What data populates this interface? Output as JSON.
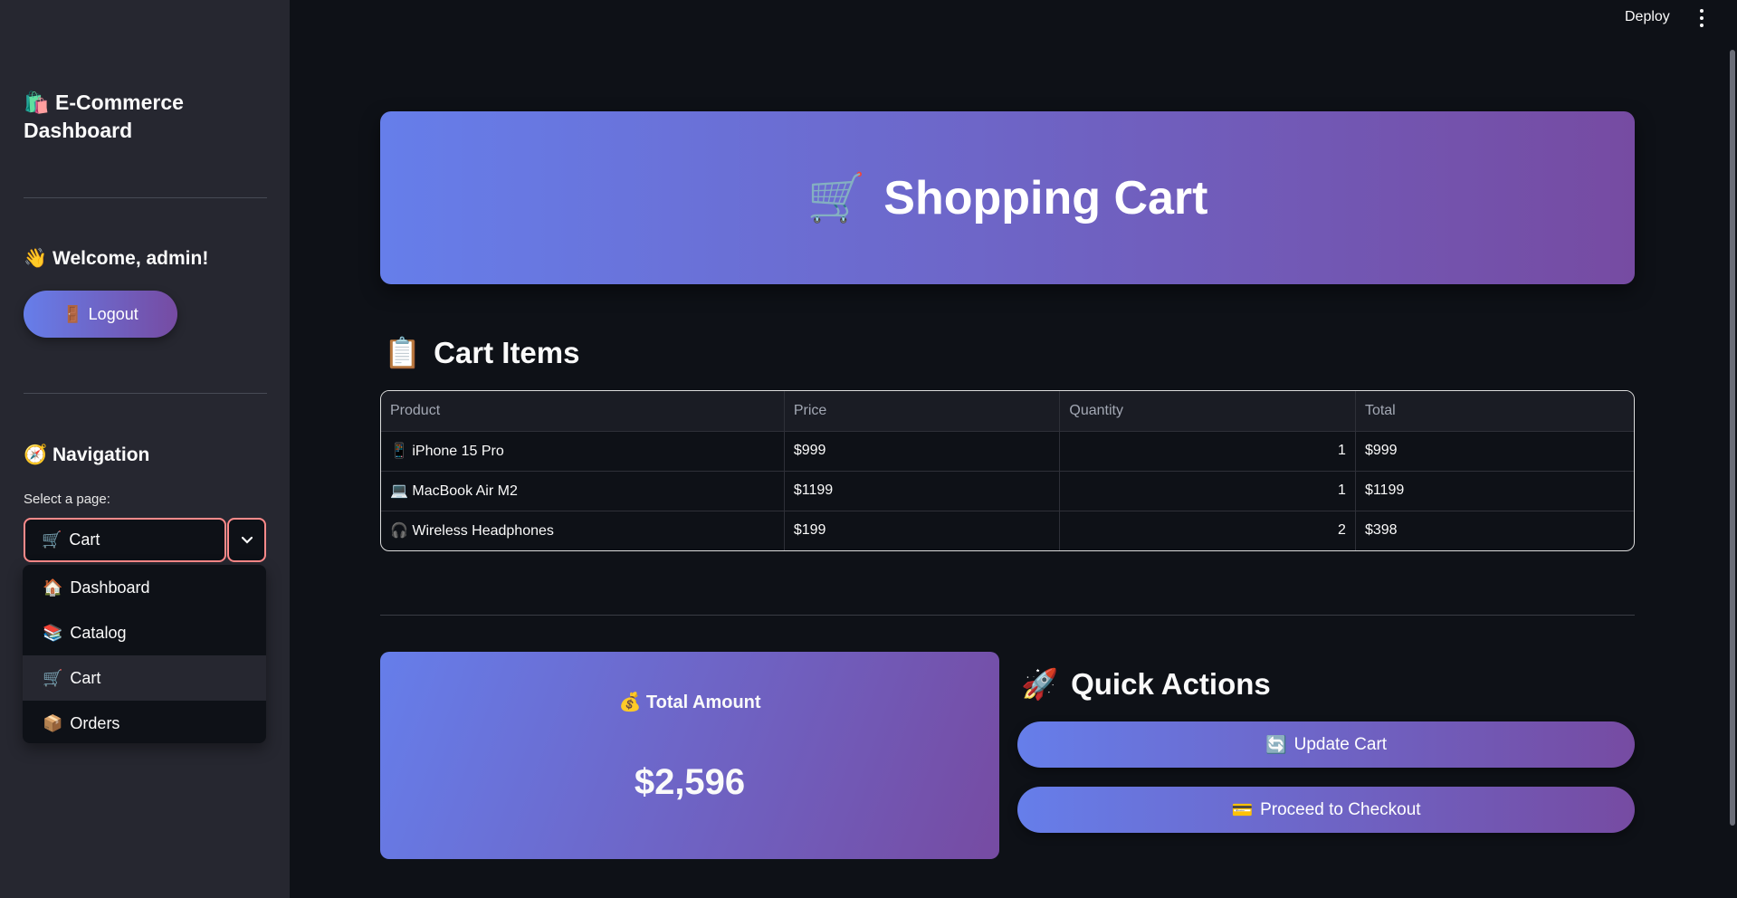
{
  "topbar": {
    "deploy_label": "Deploy"
  },
  "sidebar": {
    "title_icon": "🛍️",
    "title": "E-Commerce Dashboard",
    "welcome_icon": "👋",
    "welcome": "Welcome, admin!",
    "logout_icon": "🚪",
    "logout_label": "Logout",
    "nav_icon": "🧭",
    "nav_title": "Navigation",
    "select_label": "Select a page:",
    "selected": {
      "icon": "🛒",
      "label": "Cart"
    },
    "options": [
      {
        "icon": "🏠",
        "label": "Dashboard"
      },
      {
        "icon": "📚",
        "label": "Catalog"
      },
      {
        "icon": "🛒",
        "label": "Cart"
      },
      {
        "icon": "📦",
        "label": "Orders"
      }
    ]
  },
  "hero": {
    "icon": "🛒",
    "title": "Shopping Cart"
  },
  "cart": {
    "icon": "📋",
    "title": "Cart Items",
    "columns": [
      "Product",
      "Price",
      "Quantity",
      "Total"
    ],
    "rows": [
      {
        "icon": "📱",
        "product": "iPhone 15 Pro",
        "price": "$999",
        "quantity": "1",
        "total": "$999"
      },
      {
        "icon": "💻",
        "product": "MacBook Air M2",
        "price": "$1199",
        "quantity": "1",
        "total": "$1199"
      },
      {
        "icon": "🎧",
        "product": "Wireless Headphones",
        "price": "$199",
        "quantity": "2",
        "total": "$398"
      }
    ]
  },
  "total": {
    "icon": "💰",
    "label": "Total Amount",
    "value": "$2,596"
  },
  "actions": {
    "icon": "🚀",
    "title": "Quick Actions",
    "update_icon": "🔄",
    "update_label": "Update Cart",
    "checkout_icon": "💳",
    "checkout_label": "Proceed to Checkout"
  },
  "colors": {
    "gradient_start": "#667eea",
    "gradient_end": "#764ba2",
    "background": "#0e1117",
    "sidebar": "#262730"
  }
}
